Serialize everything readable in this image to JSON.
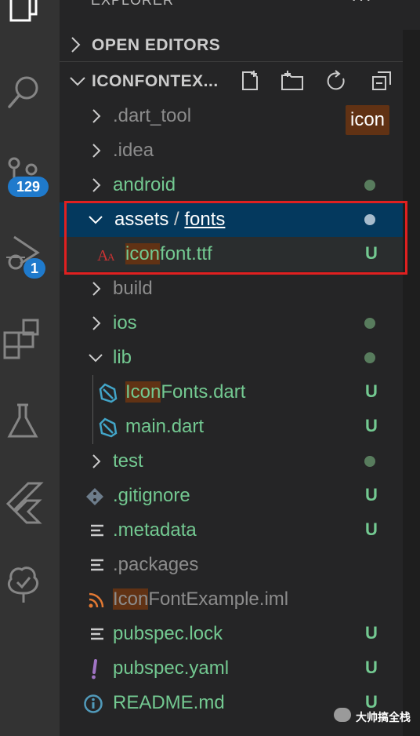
{
  "activity_bar": {
    "scm_badge": "129",
    "debug_badge": "1"
  },
  "explorer": {
    "title": "EXPLORER",
    "more": "···",
    "open_editors": "OPEN EDITORS",
    "project_title": "ICONFONTEX..."
  },
  "tooltip": "icon",
  "tree": {
    "dart_tool": ".dart_tool",
    "idea": ".idea",
    "android": "android",
    "assets": "assets",
    "sep": "/",
    "fonts": "fonts",
    "iconfont_hl": "icon",
    "iconfont_rest": "font.ttf",
    "iconfont_status": "U",
    "build": "build",
    "ios": "ios",
    "lib": "lib",
    "iconfonts_hl": "Icon",
    "iconfonts_rest": "Fonts.dart",
    "iconfonts_status": "U",
    "main": "main.dart",
    "main_status": "U",
    "test": "test",
    "gitignore": ".gitignore",
    "gitignore_status": "U",
    "metadata": ".metadata",
    "metadata_status": "U",
    "packages": ".packages",
    "iml_hl": "Icon",
    "iml_rest": "FontExample.iml",
    "pubspec_lock": "pubspec.lock",
    "pubspec_lock_status": "U",
    "pubspec_yaml": "pubspec.yaml",
    "pubspec_yaml_status": "U",
    "readme": "README.md",
    "readme_status": "U"
  },
  "watermark": "大帅搞全栈",
  "colors": {
    "untracked": "#73c991",
    "selection": "#04395e",
    "highlight": "#613214",
    "annotation": "#e02020",
    "badge": "#1f7acc"
  }
}
